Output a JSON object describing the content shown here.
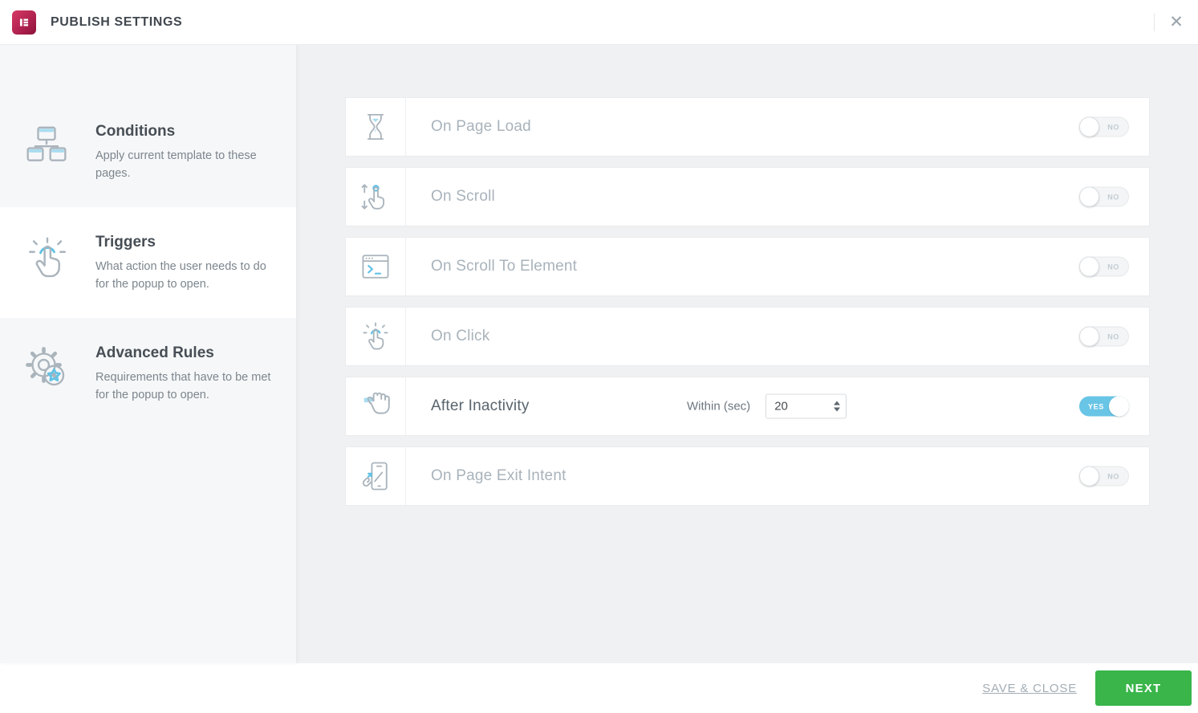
{
  "header": {
    "title": "PUBLISH SETTINGS",
    "close_glyph": "✕"
  },
  "sidebar": {
    "items": [
      {
        "label": "Conditions",
        "description": "Apply current template to these pages.",
        "icon": "sitemap-icon",
        "selected": false
      },
      {
        "label": "Triggers",
        "description": "What action the user needs to do for the popup to open.",
        "icon": "tap-hand-icon",
        "selected": true
      },
      {
        "label": "Advanced Rules",
        "description": "Requirements that have to be met for the popup to open.",
        "icon": "gear-star-icon",
        "selected": false
      }
    ]
  },
  "triggers": {
    "rows": [
      {
        "label": "On Page Load",
        "icon": "hourglass-icon",
        "enabled": false,
        "toggle": "NO"
      },
      {
        "label": "On Scroll",
        "icon": "scroll-hand-icon",
        "enabled": false,
        "toggle": "NO"
      },
      {
        "label": "On Scroll To Element",
        "icon": "window-terminal-icon",
        "enabled": false,
        "toggle": "NO"
      },
      {
        "label": "On Click",
        "icon": "click-hand-icon",
        "enabled": false,
        "toggle": "NO"
      },
      {
        "label": "After Inactivity",
        "icon": "press-hold-hand-icon",
        "enabled": true,
        "toggle": "YES",
        "field": {
          "label": "Within (sec)",
          "value": "20"
        }
      },
      {
        "label": "On Page Exit Intent",
        "icon": "phone-exit-icon",
        "enabled": false,
        "toggle": "NO"
      }
    ]
  },
  "footer": {
    "save_close_label": "SAVE & CLOSE",
    "next_label": "NEXT"
  },
  "colors": {
    "accent_blue": "#69c5e6",
    "next_green": "#39b54a",
    "logo_gradient_start": "#d63964",
    "logo_gradient_end": "#8c1238"
  }
}
